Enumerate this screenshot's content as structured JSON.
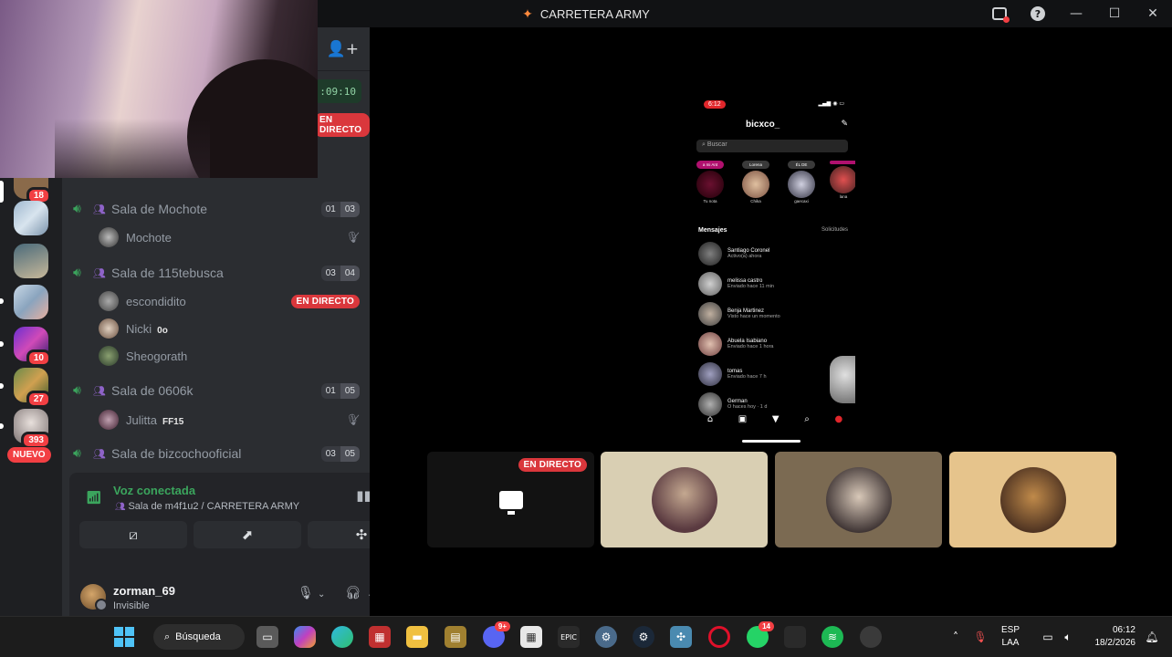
{
  "window": {
    "title": "CARRETERA ARMY",
    "icon": "carretera-army-icon"
  },
  "server_list": {
    "badges": [
      "18",
      "10",
      "27",
      "393"
    ],
    "new_label": "NUEVO"
  },
  "sidebar": {
    "timer": ":09:10",
    "live_label": "EN DIRECTO",
    "voice_channels": [
      {
        "name": "Sala de Mochote",
        "count": "01",
        "limit": "03",
        "users": [
          {
            "name": "Mochote",
            "muted": true
          }
        ]
      },
      {
        "name": "Sala de 115tebusca",
        "count": "03",
        "limit": "04",
        "users": [
          {
            "name": "escondidito",
            "live": "EN DIRECTO"
          },
          {
            "name": "Nicki",
            "tag": "0o"
          },
          {
            "name": "Sheogorath"
          }
        ]
      },
      {
        "name": "Sala de 0606k",
        "count": "01",
        "limit": "05",
        "users": [
          {
            "name": "Julitta",
            "tag": "FF15",
            "muted": true
          }
        ]
      },
      {
        "name": "Sala de bizcochooficial",
        "count": "03",
        "limit": "05",
        "users": []
      }
    ]
  },
  "voice_panel": {
    "status": "Voz conectada",
    "location": "Sala de m4f1u2 / CARRETERA ARMY"
  },
  "user_panel": {
    "username": "zorman_69",
    "status": "Invisible"
  },
  "stage": {
    "live_label": "EN DIRECTO",
    "phone": {
      "time": "6:12",
      "username": "bicxco_",
      "search_placeholder": "Buscar",
      "notes": [
        {
          "bubble": "a mi Ant",
          "name": "Tu nota"
        },
        {
          "bubble": "Lorena",
          "name": "Chika"
        },
        {
          "bubble": "ÉL DE",
          "name": "gaecaxi"
        },
        {
          "bubble": "",
          "name": "lana"
        }
      ],
      "messages_label": "Mensajes",
      "requests_label": "Solicitudes",
      "conversations": [
        {
          "name": "Santiago Coronel",
          "snippet": "Activo(a) ahora"
        },
        {
          "name": "melissa castro",
          "snippet": "Enviado hace 11 min"
        },
        {
          "name": "Benja Martinez",
          "snippet": "Visto hace un momento"
        },
        {
          "name": "Abuela Isabiano",
          "snippet": "Enviado hace 1 hora"
        },
        {
          "name": "tomas",
          "snippet": "Enviado hace 7 h"
        },
        {
          "name": "German",
          "snippet": "O haces hoy · 1 d"
        }
      ]
    }
  },
  "taskbar": {
    "search_label": "Búsqueda",
    "discord_badge": "9+",
    "whatsapp_badge": "14",
    "lang_line1": "ESP",
    "lang_line2": "LAA",
    "time": "06:12",
    "date": "18/2/2026"
  },
  "colors": {
    "accent_green": "#3ba55d",
    "live_red": "#da373c",
    "badge_red": "#f23f43",
    "sidebar_bg": "#2b2d31",
    "server_bg": "#1e1f22"
  }
}
